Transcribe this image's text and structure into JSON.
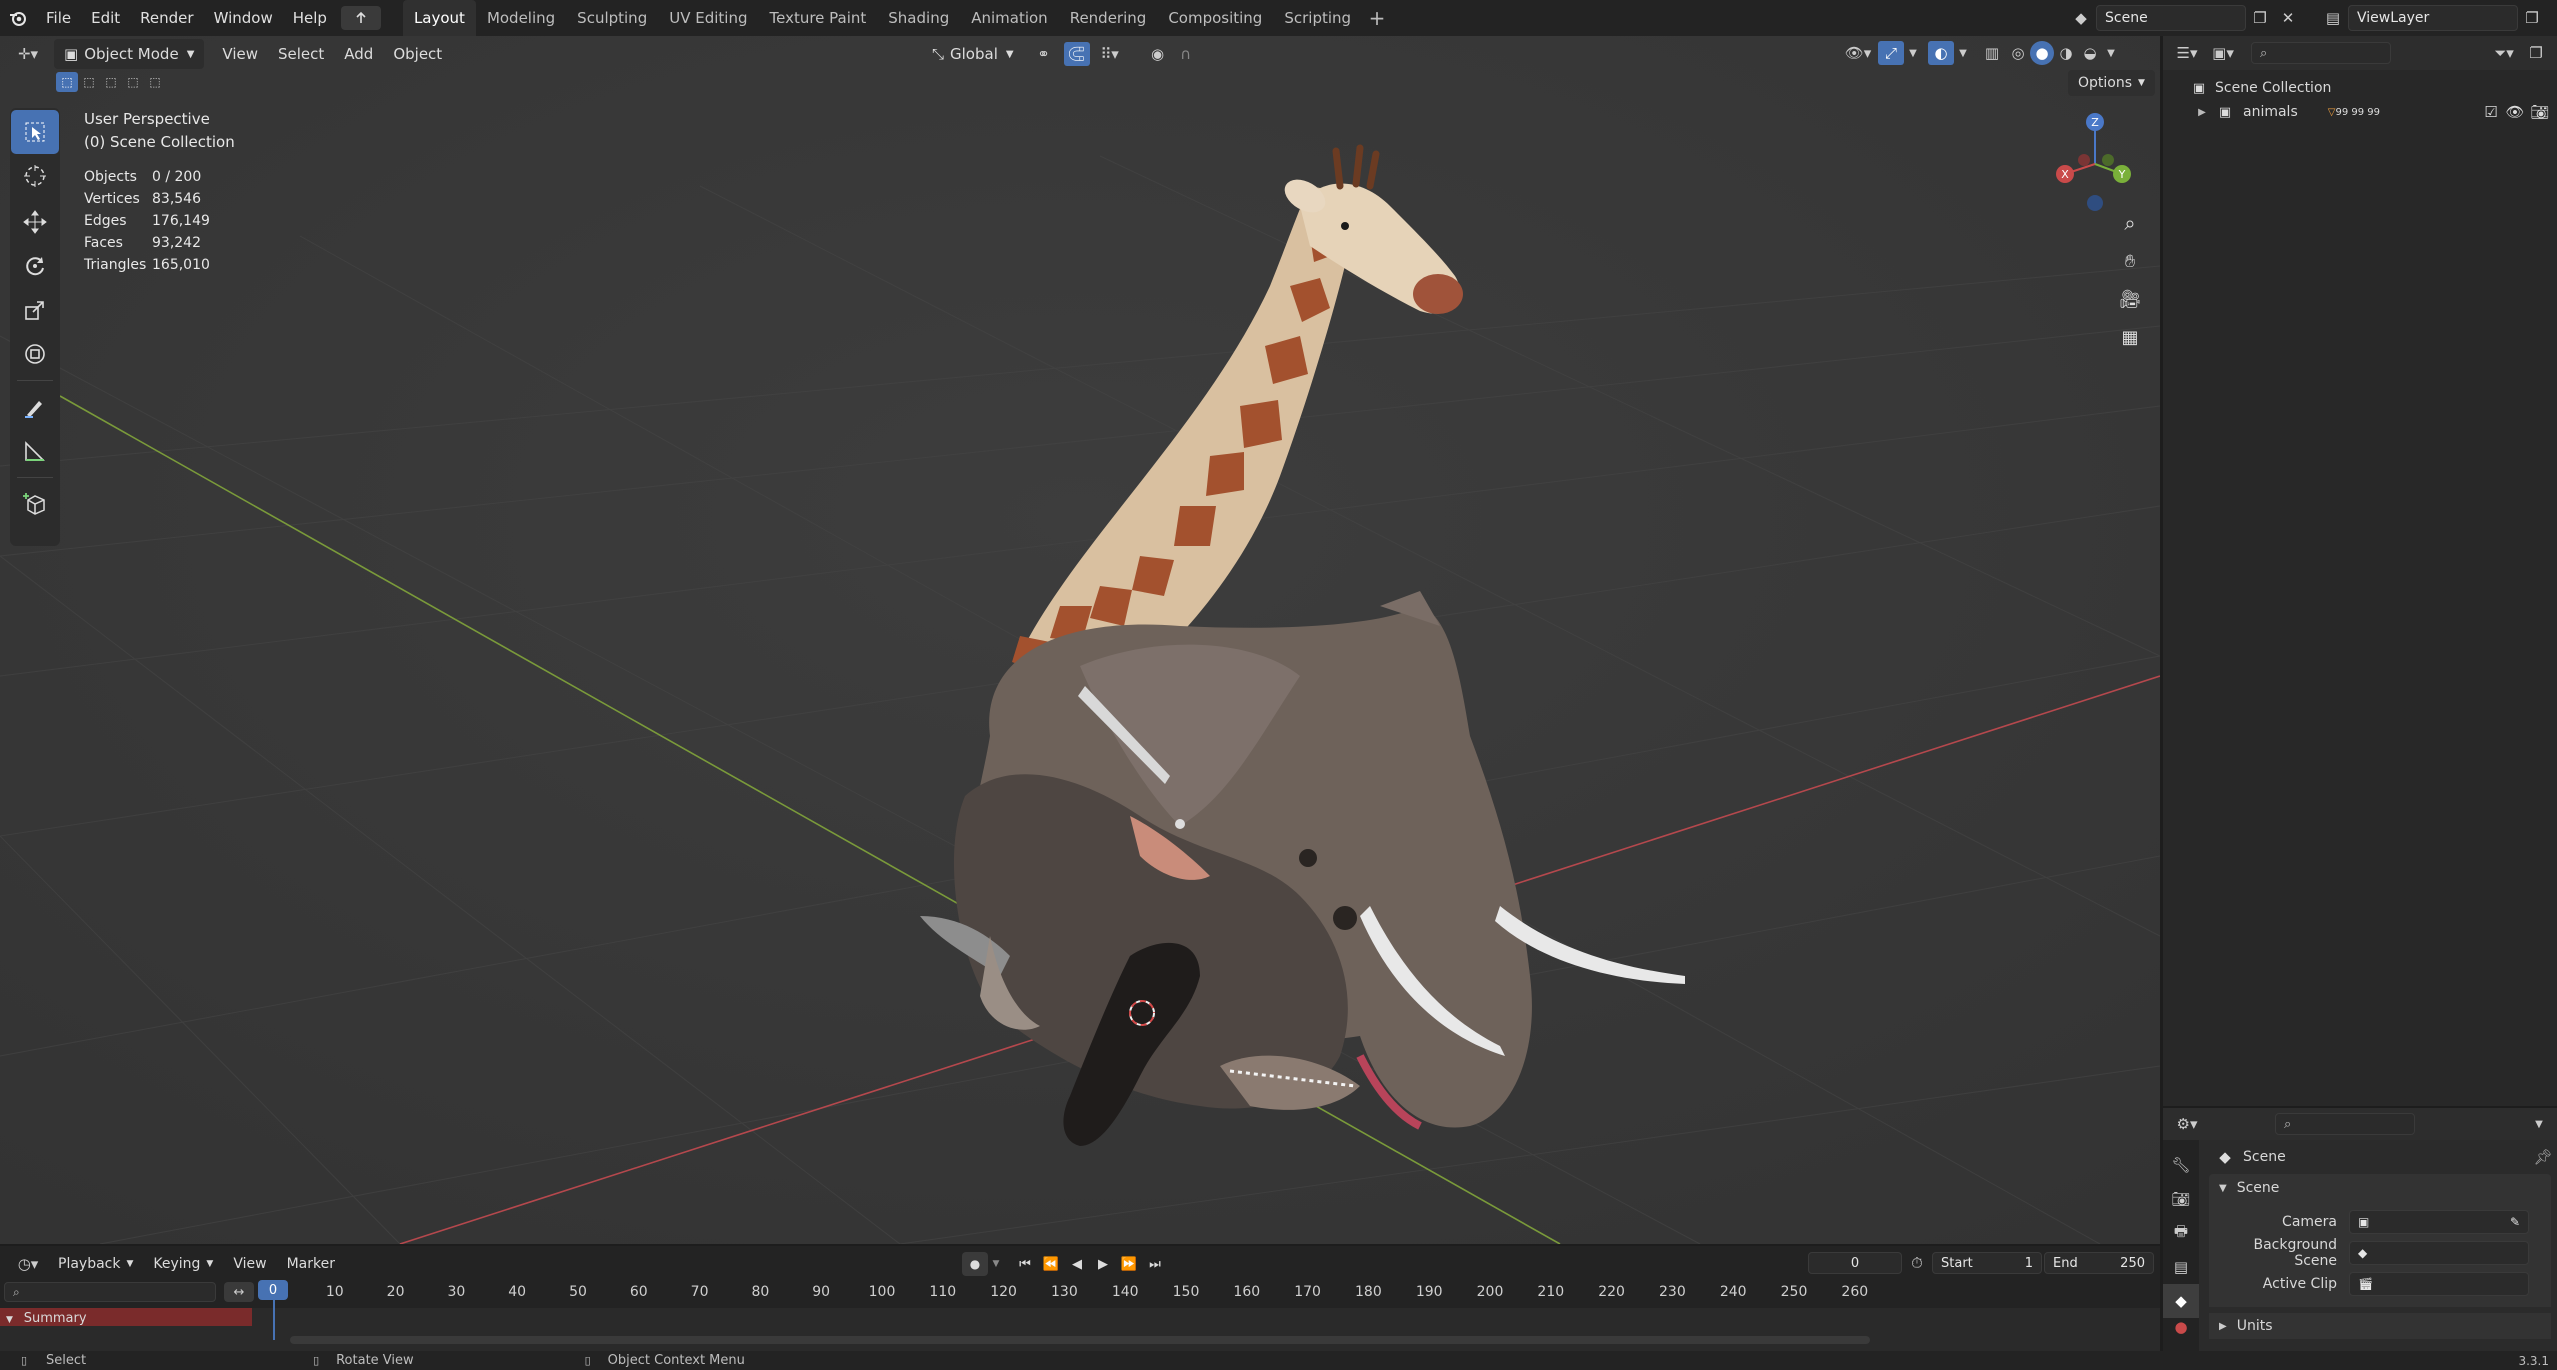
{
  "topbar": {
    "menus": [
      "File",
      "Edit",
      "Render",
      "Window",
      "Help"
    ],
    "workspaces": [
      "Layout",
      "Modeling",
      "Sculpting",
      "UV Editing",
      "Texture Paint",
      "Shading",
      "Animation",
      "Rendering",
      "Compositing",
      "Scripting"
    ],
    "active_workspace": "Layout",
    "scene_name": "Scene",
    "view_layer": "ViewLayer"
  },
  "viewport_header": {
    "mode": "Object Mode",
    "menus": [
      "View",
      "Select",
      "Add",
      "Object"
    ],
    "transform_orientation": "Global",
    "options_label": "Options"
  },
  "viewport_overlay": {
    "perspective": "User Perspective",
    "collection": "(0) Scene Collection",
    "stats": [
      {
        "label": "Objects",
        "value": "0 / 200"
      },
      {
        "label": "Vertices",
        "value": "83,546"
      },
      {
        "label": "Edges",
        "value": "176,149"
      },
      {
        "label": "Faces",
        "value": "93,242"
      },
      {
        "label": "Triangles",
        "value": "165,010"
      }
    ]
  },
  "gizmo": {
    "x": "X",
    "y": "Y",
    "z": "Z"
  },
  "outliner": {
    "root": "Scene Collection",
    "items": [
      {
        "label": "animals",
        "counts": "99 99 99"
      }
    ]
  },
  "properties": {
    "context": "Scene",
    "panel": "Scene",
    "fields": [
      {
        "label": "Camera",
        "value": ""
      },
      {
        "label": "Background Scene",
        "value": ""
      },
      {
        "label": "Active Clip",
        "value": ""
      }
    ],
    "collapsed_panel": "Units"
  },
  "timeline": {
    "menus": [
      "Playback",
      "Keying",
      "View",
      "Marker"
    ],
    "current_frame": "0",
    "start_label": "Start",
    "start_value": "1",
    "end_label": "End",
    "end_value": "250",
    "frames": [
      "0",
      "10",
      "20",
      "30",
      "40",
      "50",
      "60",
      "70",
      "80",
      "90",
      "100",
      "110",
      "120",
      "130",
      "140",
      "150",
      "160",
      "170",
      "180",
      "190",
      "200",
      "210",
      "220",
      "230",
      "240",
      "250",
      "260"
    ],
    "summary_label": "Summary"
  },
  "statusbar": {
    "select": "Select",
    "rotate": "Rotate View",
    "context_menu": "Object Context Menu",
    "version": "3.3.1"
  },
  "colors": {
    "accent": "#4772b3",
    "viewport_bg": "#393939",
    "axis_x": "#b5484d",
    "axis_y": "#7a9a3a",
    "summary_bg": "#7a2b2b"
  }
}
